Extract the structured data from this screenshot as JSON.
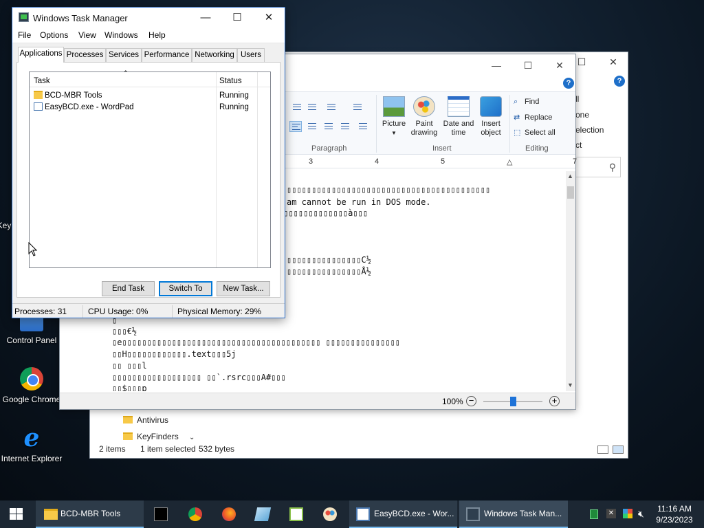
{
  "desktop": {
    "icons": [
      {
        "label": "Control Panel"
      },
      {
        "label": "Google Chrome"
      },
      {
        "label": "Internet Explorer"
      }
    ],
    "partial_label": "Key"
  },
  "explorer": {
    "ribbon_items": [
      "ll",
      "one",
      "election",
      "ct"
    ],
    "nav_items": [
      "Antivirus",
      "KeyFinders"
    ],
    "status": {
      "items": "2 items",
      "selected": "1 item selected",
      "size": "532 bytes"
    }
  },
  "wordpad": {
    "ribbon": {
      "groups": [
        "Paragraph",
        "Insert",
        "Editing"
      ],
      "insert_buttons": [
        "Picture",
        "Paint drawing",
        "Date and time",
        "Insert object"
      ],
      "editing": [
        "Find",
        "Replace",
        "Select all"
      ]
    },
    "ruler_marks": [
      "3",
      "4",
      "5",
      "7"
    ],
    "doc_lines": [
      "▯▯▯▯▯▯▯▯▯▯▯▯▯▯▯▯▯▯▯▯▯▯▯▯▯▯▯▯▯▯▯▯▯▯▯▯▯▯▯▯▯",
      "am cannot be run in DOS mode.",
      "$▯▯▯▯▯▯▯▯▯▯▯▯▯à▯▯▯",
      "▯▯▯▯▯▯▯▯▯▯▯▯▯▯▯C½",
      "▯▯▯▯▯▯▯▯▯▯▯▯▯▯▯Å½",
      "▯",
      "▯▯▯€½",
      "▯e▯▯▯▯▯▯▯▯▯▯▯▯▯▯▯▯▯▯▯▯▯▯▯▯▯▯▯▯▯▯▯▯▯▯▯▯▯▯▯▯ ▯▯▯▯▯▯▯▯▯▯▯▯▯▯▯",
      "▯▯H▯▯▯▯▯▯▯▯▯▯▯▯.text▯▯▯5j",
      "▯▯ ▯▯▯l",
      "▯▯▯▯▯▯▯▯▯▯▯▯▯▯▯▯▯▯ ▯▯`.rsrc▯▯▯A#▯▯▯",
      "▯▯$▯▯▯p"
    ],
    "zoom": {
      "label": "100%",
      "minus": "−",
      "plus": "+",
      "level_percent": 100
    }
  },
  "taskmgr": {
    "title": "Windows Task Manager",
    "menu": [
      "File",
      "Options",
      "View",
      "Windows",
      "Help"
    ],
    "tabs": [
      "Applications",
      "Processes",
      "Services",
      "Performance",
      "Networking",
      "Users"
    ],
    "active_tab": "Applications",
    "columns": {
      "task": "Task",
      "status": "Status"
    },
    "rows": [
      {
        "task": "BCD-MBR Tools",
        "status": "Running",
        "icon": "folder-icon"
      },
      {
        "task": "EasyBCD.exe - WordPad",
        "status": "Running",
        "icon": "wordpad-icon"
      }
    ],
    "buttons": {
      "end_task": "End Task",
      "switch_to": "Switch To",
      "new_task": "New Task..."
    },
    "status": {
      "processes": "Processes: 31",
      "cpu": "CPU Usage: 0%",
      "memory": "Physical Memory: 29%"
    }
  },
  "taskbar": {
    "items": [
      {
        "label": "BCD-MBR Tools",
        "icon": "folder-icon"
      },
      {
        "label": "EasyBCD.exe - Wor...",
        "icon": "wordpad-icon"
      },
      {
        "label": "Windows Task Man...",
        "icon": "taskmgr-icon"
      }
    ],
    "pinned": [
      "cmd-icon",
      "chrome-icon",
      "firefox-icon",
      "notepad-icon",
      "notepadpp-icon",
      "paint-icon"
    ],
    "time": "11:16 AM",
    "date": "9/23/2023"
  },
  "colors": {
    "accent": "#0078d7",
    "taskbar": "#1c2733"
  }
}
